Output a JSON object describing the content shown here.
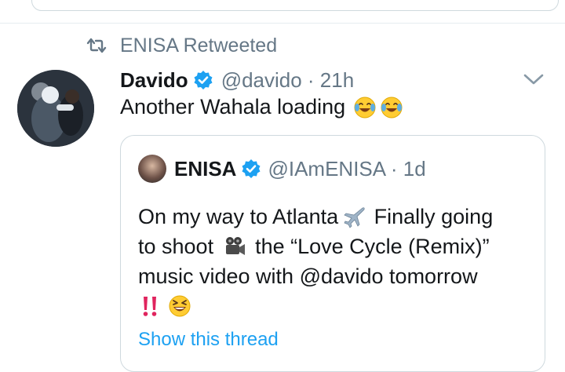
{
  "retweet_context": {
    "icon": "retweet-icon",
    "label": "ENISA Retweeted"
  },
  "tweet": {
    "author_name": "Davido",
    "verified": true,
    "handle_time": "@davido · 21h",
    "text": "Another Wahala loading",
    "emojis": [
      "face-with-tears-of-joy",
      "face-with-tears-of-joy"
    ],
    "menu_icon": "chevron-down-icon"
  },
  "quoted_tweet": {
    "author_name": "ENISA",
    "verified": true,
    "handle_time": "@IAmENISA · 1d",
    "lines": [
      {
        "text_a": "On my way to Atlanta",
        "icon": "airplane-icon",
        "text_b": " Finally going"
      },
      {
        "text_a": "to shoot ",
        "icon": "movie-camera-icon",
        "text_b": " the “Love Cycle (Remix)”"
      },
      {
        "text_a": "music video with @davido tomorrow",
        "icon": "",
        "text_b": ""
      }
    ],
    "trailing_emojis": [
      "double-exclamation-icon",
      "grinning-squinting-face-icon"
    ],
    "show_thread_label": "Show this thread"
  },
  "colors": {
    "accent": "#1da1f2",
    "secondary_text": "#657786",
    "primary_text": "#14171a",
    "border": "#cfd9de"
  }
}
